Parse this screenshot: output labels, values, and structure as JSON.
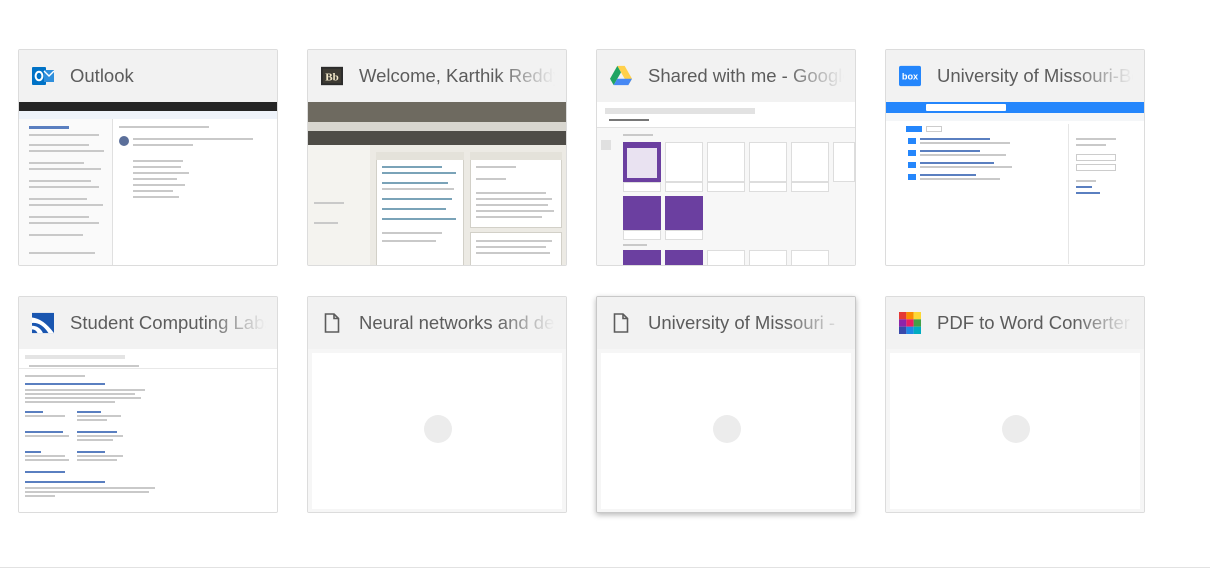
{
  "tiles": [
    {
      "title": "Outlook",
      "favicon": "outlook-icon",
      "state": "thumbnail"
    },
    {
      "title": "Welcome, Karthik Reddy",
      "favicon": "blackboard-icon",
      "state": "thumbnail"
    },
    {
      "title": "Shared with me - Google Drive",
      "favicon": "google-drive-icon",
      "state": "thumbnail"
    },
    {
      "title": "University of Missouri-Box",
      "favicon": "box-icon",
      "state": "thumbnail"
    },
    {
      "title": "Student Computing Labs",
      "favicon": "student-computing-icon",
      "state": "thumbnail"
    },
    {
      "title": "Neural networks and deep learning",
      "favicon": "document-icon",
      "state": "loading"
    },
    {
      "title": "University of Missouri - ",
      "favicon": "document-icon",
      "state": "loading",
      "focused": true
    },
    {
      "title": "PDF to Word Converter",
      "favicon": "pdf-converter-icon",
      "state": "loading"
    }
  ],
  "colors": {
    "outlook_blue": "#0072c6",
    "blackboard_dark": "#2b2b2b",
    "box_blue": "#2486fc",
    "drive_green": "#1fa463",
    "drive_yellow": "#ffd04b",
    "drive_blue": "#4688f4",
    "purple_thumb": "#6b3fa0"
  }
}
